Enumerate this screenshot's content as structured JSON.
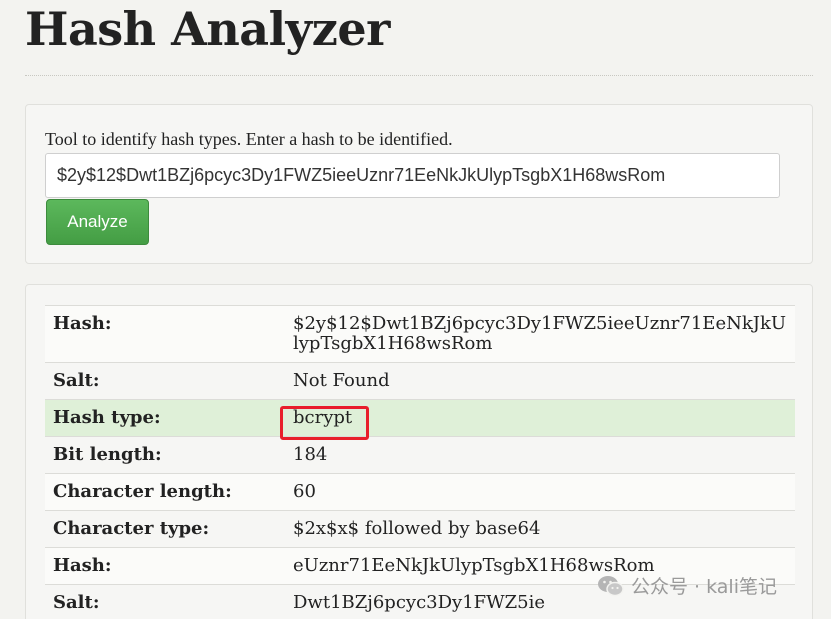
{
  "header": {
    "title": "Hash Analyzer"
  },
  "form": {
    "description": "Tool to identify hash types. Enter a hash to be identified.",
    "hash_value": "$2y$12$Dwt1BZj6pcyc3Dy1FWZ5ieeUznr71EeNkJkUlypTsgbX1H68wsRom",
    "analyze_label": "Analyze"
  },
  "results": [
    {
      "key": "Hash:",
      "value": "$2y$12$Dwt1BZj6pcyc3Dy1FWZ5ieeUznr71EeNkJkUlypTsgbX1H68wsRom"
    },
    {
      "key": "Salt:",
      "value": "Not Found"
    },
    {
      "key": "Hash type:",
      "value": "bcrypt"
    },
    {
      "key": "Bit length:",
      "value": "184"
    },
    {
      "key": "Character length:",
      "value": "60"
    },
    {
      "key": "Character type:",
      "value": "$2x$x$ followed by base64"
    },
    {
      "key": "Hash:",
      "value": "eUznr71EeNkJkUlypTsgbX1H68wsRom"
    },
    {
      "key": "Salt:",
      "value": "Dwt1BZj6pcyc3Dy1FWZ5ie"
    }
  ],
  "watermark": {
    "text": "公众号 · kali笔记"
  },
  "colors": {
    "highlight_row": "#dff0d8",
    "annotation_box": "#e8202a",
    "button": "#5cb85c"
  }
}
